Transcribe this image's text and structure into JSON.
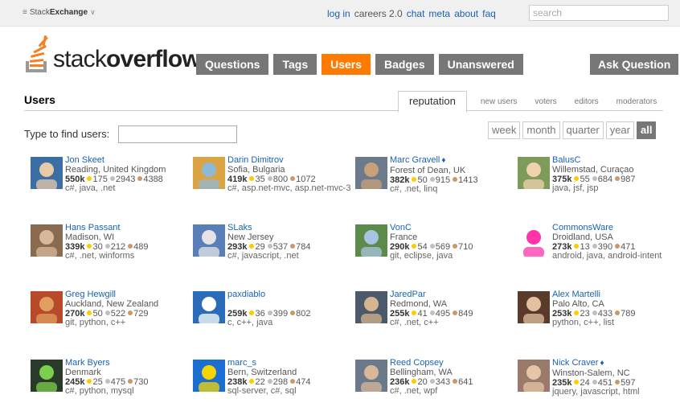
{
  "topbar": {
    "brand_prefix": "Stack",
    "brand_bold": "Exchange",
    "brand_caret": "∨",
    "links": [
      "log in",
      "careers 2.0",
      "chat",
      "meta",
      "about",
      "faq"
    ],
    "search_placeholder": "search"
  },
  "logo": {
    "light": "stack",
    "bold": "overflow"
  },
  "nav": {
    "items": [
      "Questions",
      "Tags",
      "Users",
      "Badges",
      "Unanswered"
    ],
    "active": "Users",
    "ask": "Ask Question"
  },
  "page": {
    "title": "Users",
    "tabs": [
      "reputation",
      "new users",
      "voters",
      "editors",
      "moderators"
    ],
    "active_tab": "reputation",
    "find_label": "Type to find users:",
    "periods": [
      "week",
      "month",
      "quarter",
      "year",
      "all"
    ],
    "active_period": "all"
  },
  "colors": {
    "link": "#1a62b3",
    "nav_active": "#ff7a00",
    "nav": "#777777",
    "gold": "#ffcc00",
    "silver": "#c0c0c0",
    "bronze": "#cc9966"
  },
  "users": [
    {
      "name": "Jon Skeet",
      "mod": false,
      "location": "Reading, United Kingdom",
      "rep": "550k",
      "gold": "175",
      "silver": "2943",
      "bronze": "4388",
      "tags": "c#, java, .net"
    },
    {
      "name": "Darin Dimitrov",
      "mod": false,
      "location": "Sofia, Bulgaria",
      "rep": "419k",
      "gold": "35",
      "silver": "800",
      "bronze": "1072",
      "tags": "c#, asp.net-mvc, asp.net-mvc-3"
    },
    {
      "name": "Marc Gravell",
      "mod": true,
      "location": "Forest of Dean, UK",
      "rep": "382k",
      "gold": "50",
      "silver": "915",
      "bronze": "1413",
      "tags": "c#, .net, linq"
    },
    {
      "name": "BalusC",
      "mod": false,
      "location": "Willemstad, Curaçao",
      "rep": "375k",
      "gold": "55",
      "silver": "684",
      "bronze": "987",
      "tags": "java, jsf, jsp"
    },
    {
      "name": "Hans Passant",
      "mod": false,
      "location": "Madison, WI",
      "rep": "339k",
      "gold": "30",
      "silver": "212",
      "bronze": "489",
      "tags": "c#, .net, winforms"
    },
    {
      "name": "SLaks",
      "mod": false,
      "location": "New Jersey",
      "rep": "293k",
      "gold": "29",
      "silver": "537",
      "bronze": "784",
      "tags": "c#, javascript, .net"
    },
    {
      "name": "VonC",
      "mod": false,
      "location": "France",
      "rep": "290k",
      "gold": "54",
      "silver": "569",
      "bronze": "710",
      "tags": "git, eclipse, java"
    },
    {
      "name": "CommonsWare",
      "mod": false,
      "location": "Droidland, USA",
      "rep": "273k",
      "gold": "13",
      "silver": "390",
      "bronze": "471",
      "tags": "android, java, android-intent"
    },
    {
      "name": "Greg Hewgill",
      "mod": false,
      "location": "Auckland, New Zealand",
      "rep": "270k",
      "gold": "50",
      "silver": "522",
      "bronze": "729",
      "tags": "git, python, c++"
    },
    {
      "name": "paxdiablo",
      "mod": false,
      "location": "",
      "rep": "259k",
      "gold": "36",
      "silver": "399",
      "bronze": "802",
      "tags": "c, c++, java"
    },
    {
      "name": "JaredPar",
      "mod": false,
      "location": "Redmond, WA",
      "rep": "255k",
      "gold": "41",
      "silver": "495",
      "bronze": "849",
      "tags": "c#, .net, c++"
    },
    {
      "name": "Alex Martelli",
      "mod": false,
      "location": "Palo Alto, CA",
      "rep": "253k",
      "gold": "23",
      "silver": "433",
      "bronze": "789",
      "tags": "python, c++, list"
    },
    {
      "name": "Mark Byers",
      "mod": false,
      "location": "Denmark",
      "rep": "245k",
      "gold": "25",
      "silver": "475",
      "bronze": "730",
      "tags": "c#, python, mysql"
    },
    {
      "name": "marc_s",
      "mod": false,
      "location": "Bern, Switzerland",
      "rep": "238k",
      "gold": "22",
      "silver": "298",
      "bronze": "474",
      "tags": "sql-server, c#, sql"
    },
    {
      "name": "Reed Copsey",
      "mod": false,
      "location": "Bellingham, WA",
      "rep": "236k",
      "gold": "20",
      "silver": "343",
      "bronze": "641",
      "tags": "c#, .net, wpf"
    },
    {
      "name": "Nick Craver",
      "mod": true,
      "location": "Winston-Salem, NC",
      "rep": "235k",
      "gold": "24",
      "silver": "451",
      "bronze": "597",
      "tags": "jquery, javascript, html"
    }
  ]
}
